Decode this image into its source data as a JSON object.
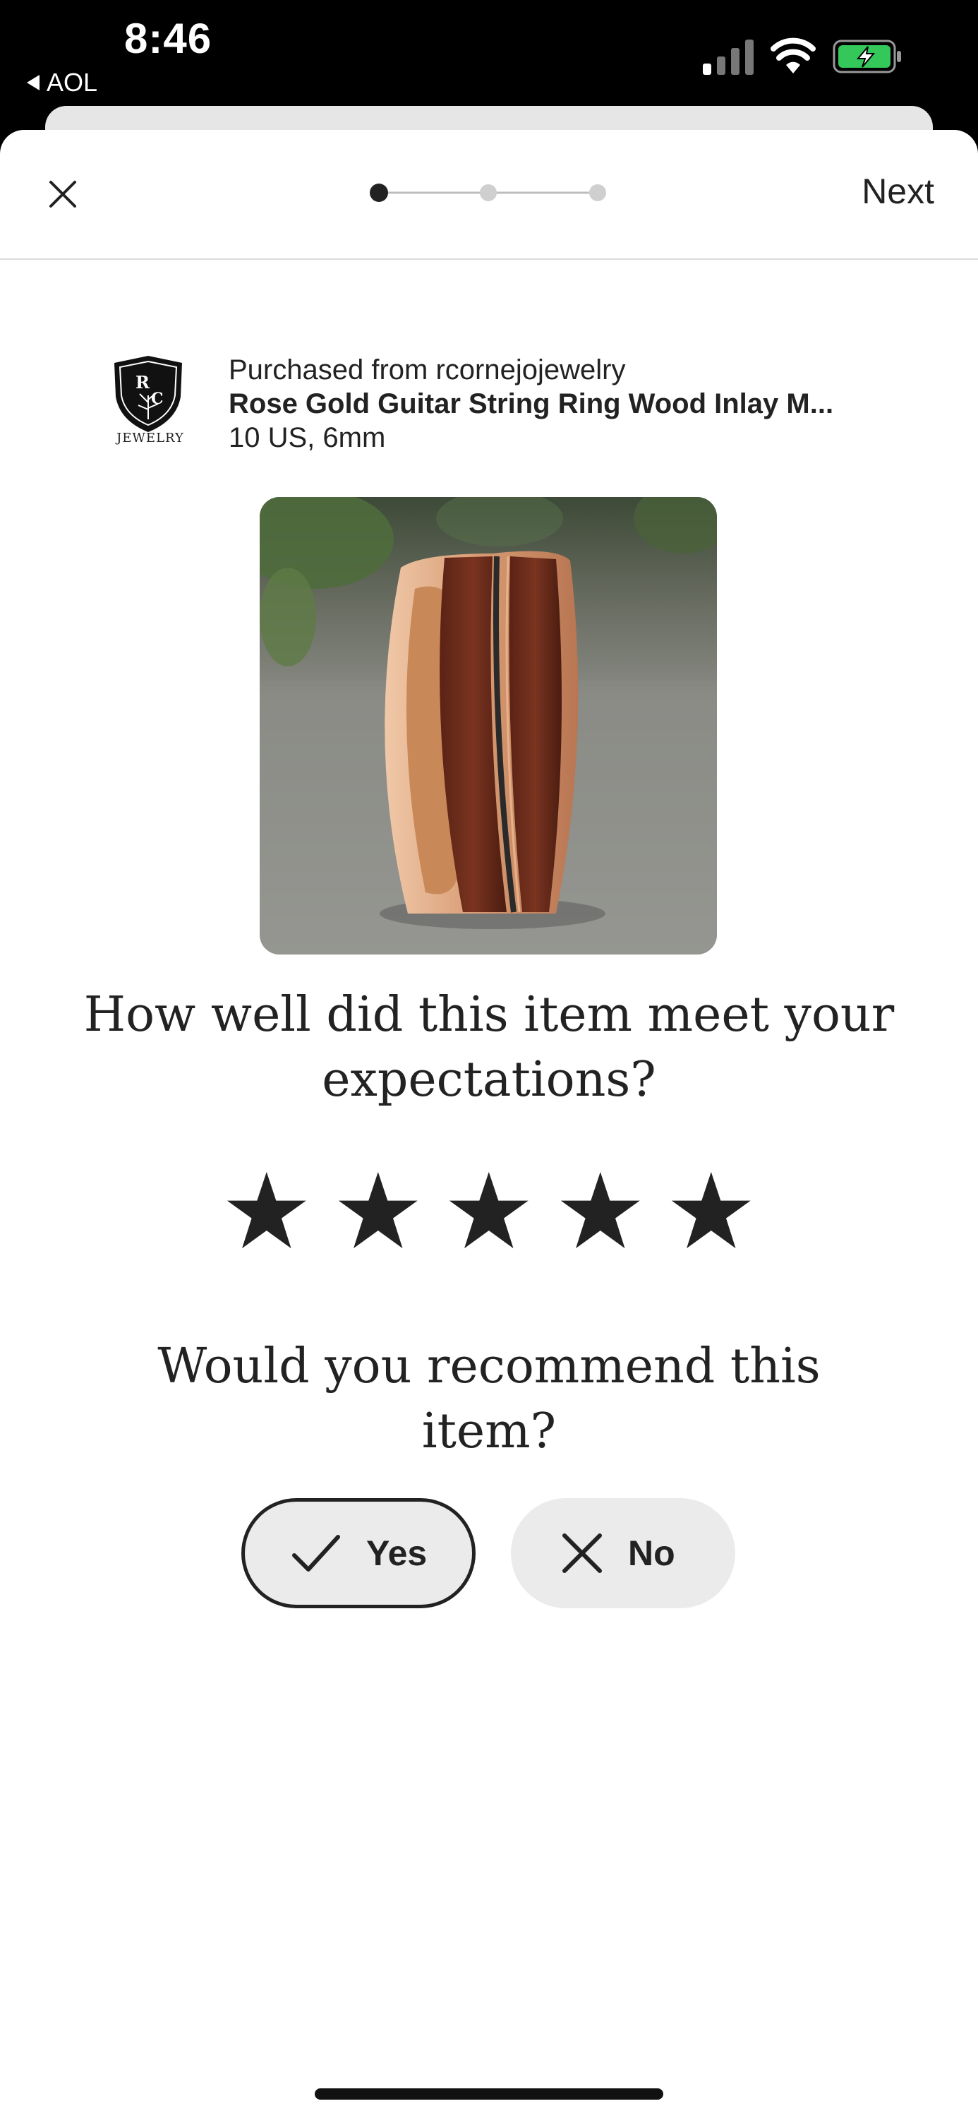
{
  "status_bar": {
    "time": "8:46",
    "back_app": "AOL",
    "icons": [
      "signal-icon",
      "wifi-icon",
      "battery-charging-icon"
    ],
    "battery_color": "#34c759"
  },
  "header": {
    "close_icon": "close-icon",
    "next_label": "Next",
    "progress": {
      "steps": 3,
      "current": 1
    }
  },
  "purchase": {
    "purchased_from": "Purchased from rcornejojewelry",
    "item_title": "Rose Gold Guitar String Ring Wood Inlay M...",
    "variation": "10 US, 6mm",
    "shop_logo_text": "JEWELRY"
  },
  "rating": {
    "question": "How well did this item meet your expectations?",
    "stars_total": 5,
    "stars_selected": 5
  },
  "recommend": {
    "question": "Would you recommend this item?",
    "yes_label": "Yes",
    "no_label": "No",
    "selected": "Yes"
  },
  "colors": {
    "text": "#222222",
    "button_bg": "#ebebeb",
    "divider": "#dcdcdc"
  }
}
